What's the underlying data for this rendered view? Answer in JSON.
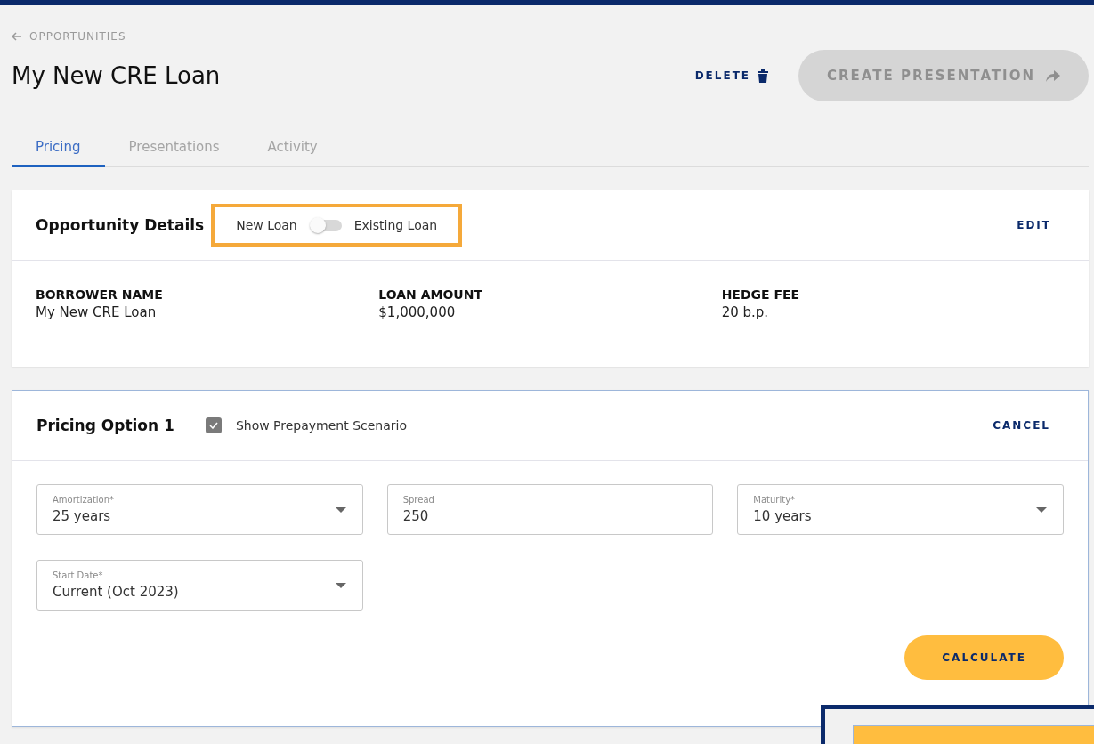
{
  "breadcrumb": {
    "label": "OPPORTUNITIES"
  },
  "title": "My New CRE Loan",
  "actions": {
    "delete": "DELETE",
    "create": {
      "label": "CREATE PRESENTATION",
      "disabled": true
    }
  },
  "tabs": [
    {
      "label": "Pricing",
      "selected": true
    },
    {
      "label": "Presentations",
      "selected": false
    },
    {
      "label": "Activity",
      "selected": false
    }
  ],
  "details": {
    "title": "Opportunity Details",
    "toggle": {
      "left": "New Loan",
      "right": "Existing Loan",
      "on": false,
      "highlighted": true
    },
    "edit": "EDIT",
    "fields": [
      {
        "label": "BORROWER NAME",
        "value": "My New CRE Loan"
      },
      {
        "label": "LOAN AMOUNT",
        "value": "$1,000,000"
      },
      {
        "label": "HEDGE FEE",
        "value": "20 b.p."
      }
    ]
  },
  "pricing": {
    "title": "Pricing Option 1",
    "checkbox": {
      "label": "Show Prepayment Scenario",
      "checked": true
    },
    "cancel": "CANCEL",
    "inputs": [
      {
        "kind": "select",
        "label": "Amortization*",
        "value": "25 years"
      },
      {
        "kind": "text",
        "label": "Spread",
        "value": "250"
      },
      {
        "kind": "select",
        "label": "Maturity*",
        "value": "10 years"
      },
      {
        "kind": "select",
        "label": "Start Date*",
        "value": "Current (Oct 2023)"
      }
    ],
    "calculate": "CALCULATE"
  }
}
